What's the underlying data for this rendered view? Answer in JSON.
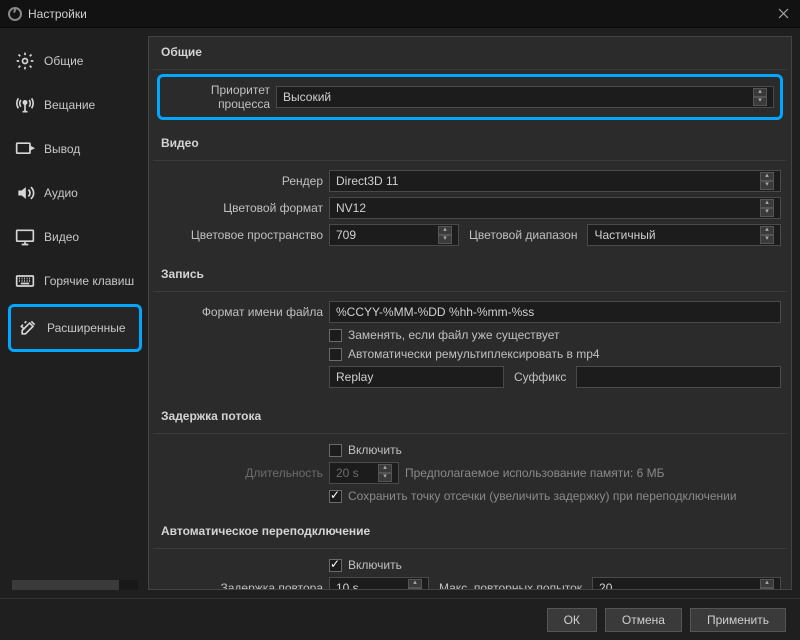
{
  "window": {
    "title": "Настройки"
  },
  "sidebar": {
    "items": [
      {
        "label": "Общие"
      },
      {
        "label": "Вещание"
      },
      {
        "label": "Вывод"
      },
      {
        "label": "Аудио"
      },
      {
        "label": "Видео"
      },
      {
        "label": "Горячие клавиш"
      },
      {
        "label": "Расширенные"
      }
    ]
  },
  "sections": {
    "general": {
      "title": "Общие",
      "priority_label": "Приоритет процесса",
      "priority_value": "Высокий"
    },
    "video": {
      "title": "Видео",
      "renderer_label": "Рендер",
      "renderer_value": "Direct3D 11",
      "color_format_label": "Цветовой формат",
      "color_format_value": "NV12",
      "color_space_label": "Цветовое пространство",
      "color_space_value": "709",
      "color_range_label": "Цветовой диапазон",
      "color_range_value": "Частичный"
    },
    "recording": {
      "title": "Запись",
      "filename_label": "Формат имени файла",
      "filename_value": "%CCYY-%MM-%DD %hh-%mm-%ss",
      "overwrite_label": "Заменять, если файл уже существует",
      "remux_label": "Автоматически ремультиплексировать в mp4",
      "replay_prefix": "Replay",
      "suffix_label": "Суффикс",
      "suffix_value": ""
    },
    "delay": {
      "title": "Задержка потока",
      "enable_label": "Включить",
      "duration_label": "Длительность",
      "duration_value": "20 s",
      "memory_label": "Предполагаемое использование памяти: 6 МБ",
      "preserve_label": "Сохранить точку отсечки (увеличить задержку) при переподключении"
    },
    "reconnect": {
      "title": "Автоматическое переподключение",
      "enable_label": "Включить",
      "retry_delay_label": "Задержка повтора",
      "retry_delay_value": "10 s",
      "max_retries_label": "Макс. повторных попыток",
      "max_retries_value": "20"
    }
  },
  "footer": {
    "ok": "ОК",
    "cancel": "Отмена",
    "apply": "Применить"
  }
}
